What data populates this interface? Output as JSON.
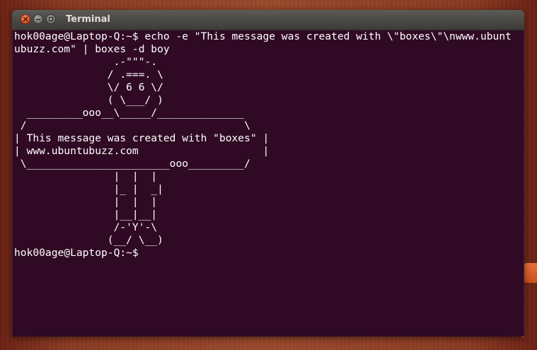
{
  "window": {
    "title": "Terminal"
  },
  "icons": {
    "close": "close-icon",
    "minimize": "minimize-icon",
    "maximize": "maximize-icon"
  },
  "colors": {
    "terminal_background": "#300a24",
    "terminal_text": "#ffffff",
    "titlebar": "#4a4945",
    "close_button": "#e0572a"
  },
  "terminal": {
    "lines": [
      "hok00age@Laptop-Q:~$ echo -e \"This message was created with \\\"boxes\\\"\\nwww.ubunt",
      "ubuzz.com\" | boxes -d boy",
      "                .-\"\"\"-.",
      "               / .===. \\",
      "               \\/ 6 6 \\/",
      "               ( \\___/ )",
      "  _________ooo__\\_____/______________",
      " /                                   \\",
      "| This message was created with \"boxes\" |",
      "| www.ubuntubuzz.com                    |",
      " \\_______________________ooo_________/",
      "                |  |  |",
      "                |_ |  _|",
      "                |  |  |",
      "                |__|__|",
      "                /-'Y'-\\",
      "               (__/ \\__)",
      "hok00age@Laptop-Q:~$"
    ]
  }
}
